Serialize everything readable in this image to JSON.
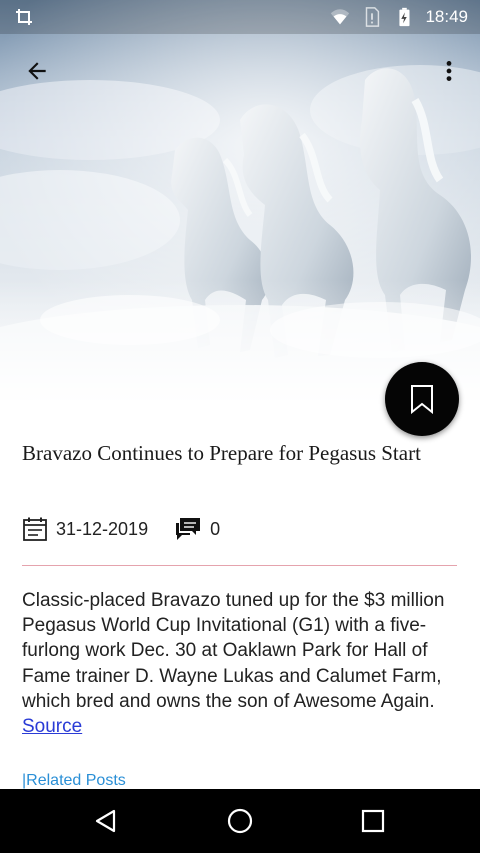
{
  "status_bar": {
    "time": "18:49",
    "icons": [
      "crop-icon",
      "wifi-icon",
      "sim-icon",
      "battery-charging-icon"
    ]
  },
  "app_bar": {
    "back_icon": "arrow-back-icon",
    "menu_icon": "more-vert-icon"
  },
  "hero_image": {
    "subject": "white-horses-running-in-mist",
    "fab_icon": "bookmark-icon"
  },
  "article": {
    "title": "Bravazo Continues to Prepare for Pegasus Start",
    "date": "31-12-2019",
    "comment_count": "0",
    "body": "Classic-placed Bravazo tuned up for the $3 million Pegasus World Cup Invitational (G1) with a five-furlong work Dec. 30 at Oaklawn Park for Hall of Fame trainer D. Wayne Lukas and Calumet Farm, which bred and owns the son of Awesome Again. ",
    "source_label": "Source",
    "related_label": "|Related Posts"
  },
  "colors": {
    "accent_link": "#2a3bd6",
    "divider": "#e5a3ad",
    "related": "#2a8fd6",
    "fab": "#050505"
  },
  "nav_bar": {
    "icons": [
      "nav-back-icon",
      "nav-home-icon",
      "nav-recents-icon"
    ]
  }
}
